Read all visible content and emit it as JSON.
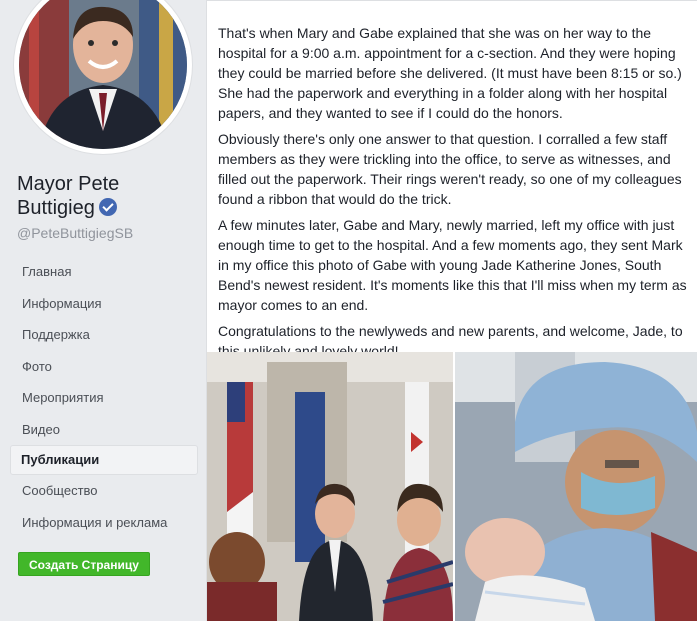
{
  "page": {
    "name": "Mayor Pete Buttigieg",
    "handle": "@PeteButtigiegSB"
  },
  "nav": {
    "items": [
      {
        "label": "Главная"
      },
      {
        "label": "Информация"
      },
      {
        "label": "Поддержка"
      },
      {
        "label": "Фото"
      },
      {
        "label": "Мероприятия"
      },
      {
        "label": "Видео"
      },
      {
        "label": "Публикации"
      },
      {
        "label": "Сообщество"
      },
      {
        "label": "Информация и реклама"
      }
    ],
    "active": "Публикации"
  },
  "create_page_label": "Создать Страницу",
  "post": {
    "paragraphs": [
      "That's when Mary and Gabe explained that she was on her way to the hospital for a 9:00 a.m. appointment for a c-section. And they were hoping they could be married before she delivered. (It must have been 8:15 or so.) She had the paperwork and everything in a folder along with her hospital papers, and they wanted to see if I could do the honors.",
      "Obviously there's only one answer to that question. I corralled a few staff members as they were trickling into the office, to serve as witnesses, and filled out the paperwork. Their rings weren't ready, so one of my colleagues found a ribbon that would do the trick.",
      "A few minutes later, Gabe and Mary, newly married, left my office with just enough time to get to the hospital. And a few moments ago, they sent Mark in my office this photo of Gabe with young Jade Katherine Jones, South Bend's newest resident. It's moments like this that I'll miss when my term as mayor comes to an end.",
      "Congratulations to the newlyweds and new parents, and welcome, Jade, to this unlikely and lovely world!"
    ]
  },
  "colors": {
    "background": "#e9ebee",
    "verified": "#4267b2",
    "create_button": "#42b72a"
  }
}
